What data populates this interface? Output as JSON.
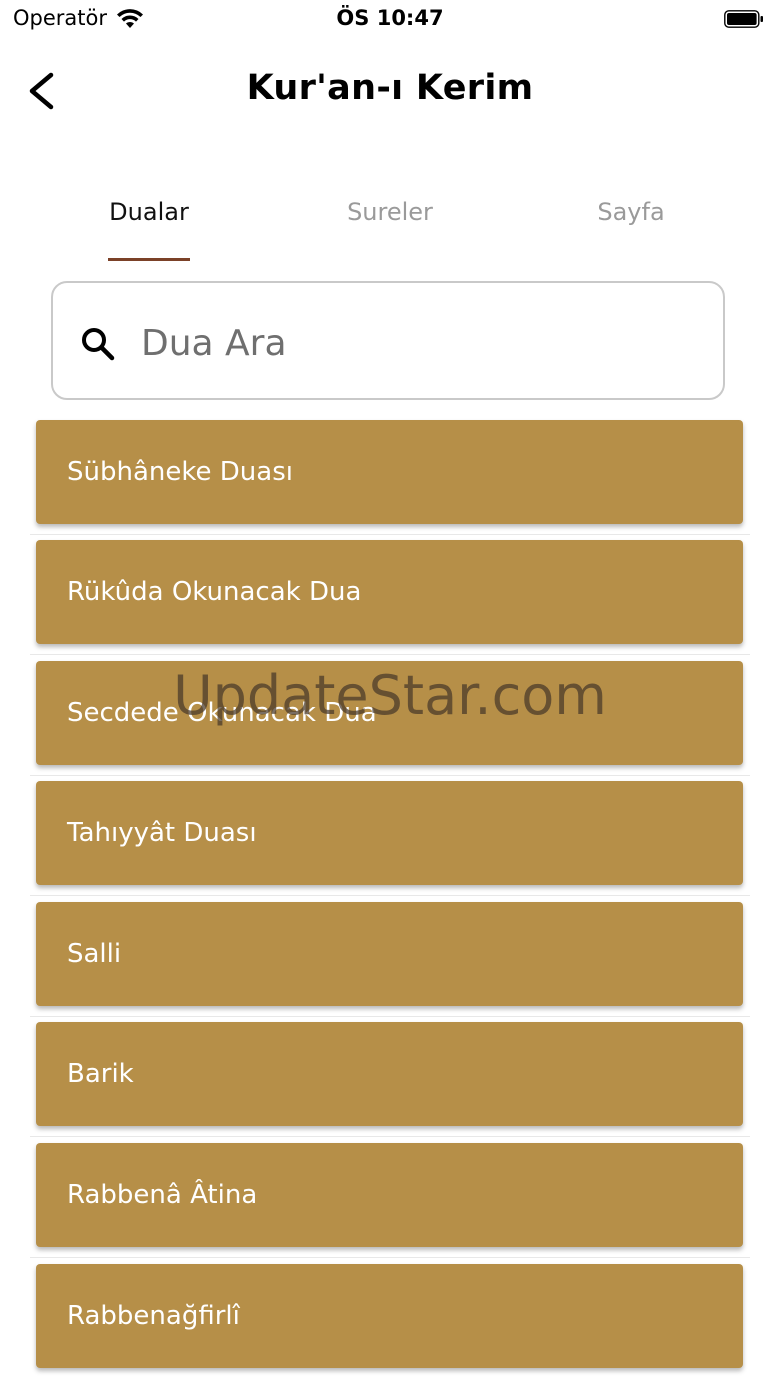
{
  "status_bar": {
    "carrier": "Operatör",
    "time": "ÖS 10:47",
    "icons": [
      "wifi-icon",
      "battery-icon"
    ]
  },
  "header": {
    "title": "Kur'an-ı Kerim",
    "back_icon": "chevron-left-icon"
  },
  "tabs": [
    {
      "label": "Dualar",
      "active": true
    },
    {
      "label": "Sureler",
      "active": false
    },
    {
      "label": "Sayfa",
      "active": false
    }
  ],
  "search": {
    "placeholder": "Dua Ara",
    "value": "",
    "icon": "search-icon"
  },
  "duas": [
    "Sübhâneke Duası",
    "Rükûda Okunacak Dua",
    "Secdede Okunacak Dua",
    "Tahıyyât Duası",
    "Salli",
    "Barik",
    "Rabbenâ Âtina",
    "Rabbenağfirlî"
  ],
  "watermark": "UpdateStar.com",
  "colors": {
    "item_background": "#b68f48",
    "item_text": "#ffffff",
    "tab_indicator": "#7b4128",
    "tab_inactive": "#9a9a9a"
  }
}
